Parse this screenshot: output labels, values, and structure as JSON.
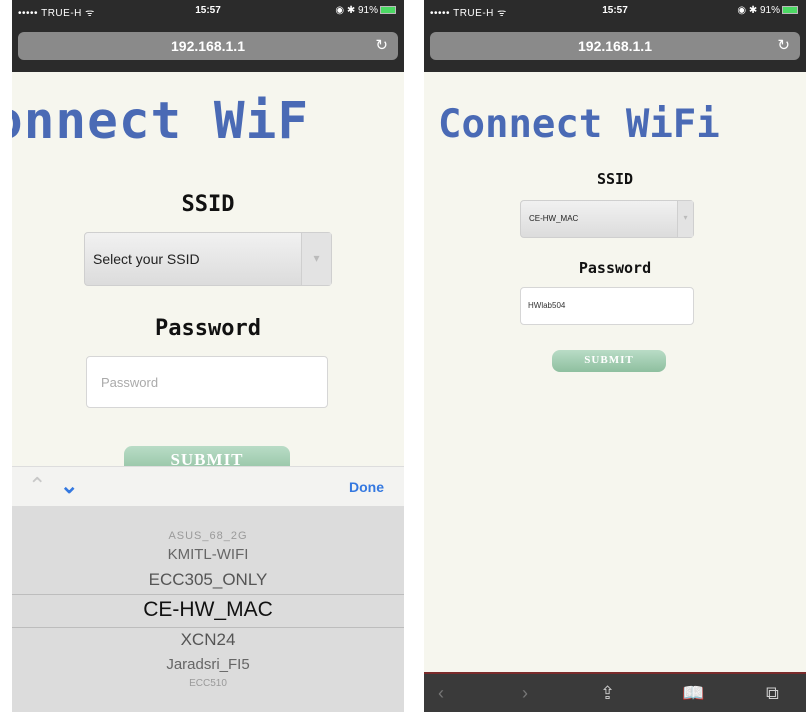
{
  "left": {
    "status": {
      "carrier": "••••• TRUE-H ᯤ",
      "time": "15:57",
      "battery": "◉ ✱ 91%"
    },
    "url": "192.168.1.1",
    "heading": "onnect WiF",
    "ssid_label": "SSID",
    "ssid_select": "Select your SSID",
    "password_label": "Password",
    "password_placeholder": "Password",
    "submit": "SUBMIT",
    "picker": {
      "done": "Done",
      "items": [
        "ASUS_68_2G",
        "KMITL-WIFI",
        "ECC305_ONLY",
        "CE-HW_MAC",
        "XCN24",
        "Jaradsri_FI5",
        "ECC510"
      ]
    }
  },
  "right": {
    "status": {
      "carrier": "••••• TRUE-H ᯤ",
      "time": "15:57",
      "battery": "◉ ✱ 91%"
    },
    "url": "192.168.1.1",
    "heading": "Connect WiFi",
    "ssid_label": "SSID",
    "ssid_select": "CE-HW_MAC",
    "password_label": "Password",
    "password_value": "HWlab504",
    "submit": "SUBMIT"
  }
}
